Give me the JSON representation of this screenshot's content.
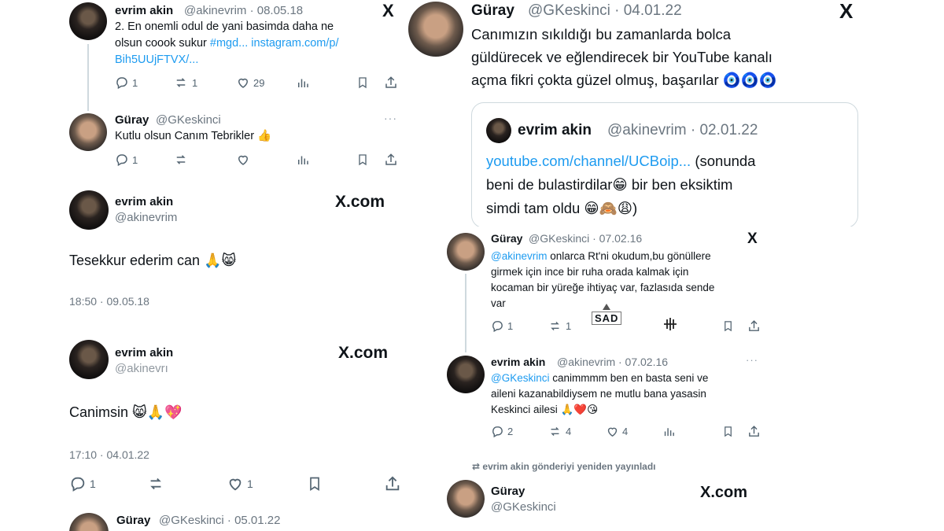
{
  "p1": {
    "name": "evrim akin",
    "handle": "@akinevrim · 08.05.18",
    "line1": "2. En onemli odul de yani basimda daha ne",
    "line2_text": "olsun coook sukur ",
    "line2_hashtag": "#mgd...",
    "line2_link": " instagram.com/p/",
    "line3_link": "Bih5UUjFTVX/...",
    "replies": "1",
    "reposts": "1",
    "likes": "29",
    "reply_name": "Güray",
    "reply_handle": "@GKeskinci",
    "reply_text": "Kutlu olsun Canım Tebrikler 👍",
    "reply_replies": "1"
  },
  "p2": {
    "name": "evrim akin",
    "handle": "@akinevrim",
    "brand": "X.com",
    "text": "Tesekkur ederim can 🙏😸",
    "time": "18:50 · 09.05.18"
  },
  "p3": {
    "name": "evrim akin",
    "handle": "@akinevrı",
    "brand": "X.com",
    "text": "Canimsin 😸🙏💖",
    "time": "17:10 · 04.01.22",
    "replies": "1",
    "likes": "1",
    "next_name": "Güray",
    "next_handle": "@GKeskinci · 05.01.22"
  },
  "p4": {
    "name": "Güray",
    "handle": "@GKeskinci · 04.01.22",
    "line1": "Canımızın sıkıldığı bu zamanlarda bolca",
    "line2": "güldürecek ve eğlendirecek bir YouTube kanalı",
    "line3": "açma fikri çokta güzel olmuş, başarılar 🧿🧿🧿",
    "quote_name": "evrim akin",
    "quote_handle": "@akinevrim · 02.01.22",
    "quote_link": "youtube.com/channel/UCBoip...",
    "quote_rest": " (sonunda",
    "quote_line2": "beni de bulastirdilar😁 bir ben eksiktim",
    "quote_line3": "simdi tam oldu 😁🙈😩)"
  },
  "p5": {
    "name": "Güray",
    "handle": "@GKeskinci · 07.02.16",
    "mention": "@akinevrim",
    "line1_rest": " onlarca Rt'ni okudum,bu gönüllere",
    "line2": "girmek için ince bir ruha orada kalmak için",
    "line3": "kocaman bir yüreğe ihtiyaç var, fazlasıda sende",
    "line4": "var",
    "replies": "1",
    "reposts": "1",
    "mid_label": "SAD",
    "reply_name": "evrim akin",
    "reply_handle": "@akinevrim · 07.02.16",
    "reply_mention": "@GKeskinci",
    "reply_line1_rest": " canimmmm ben en basta seni ve",
    "reply_line2": "aileni kazanabildiysem ne mutlu bana yasasin",
    "reply_line3": "Keskinci ailesi 🙏❤️😘",
    "reply_replies": "2",
    "reply_reposts": "4",
    "reply_likes": "4",
    "retweet_note": "evrim akin gönderiyi yeniden yayınladı",
    "last_name": "Güray",
    "last_handle": "@GKeskinci",
    "brand": "X.com"
  },
  "icons": {
    "x_logo": "X",
    "more": "···",
    "reposted": "⇄"
  }
}
